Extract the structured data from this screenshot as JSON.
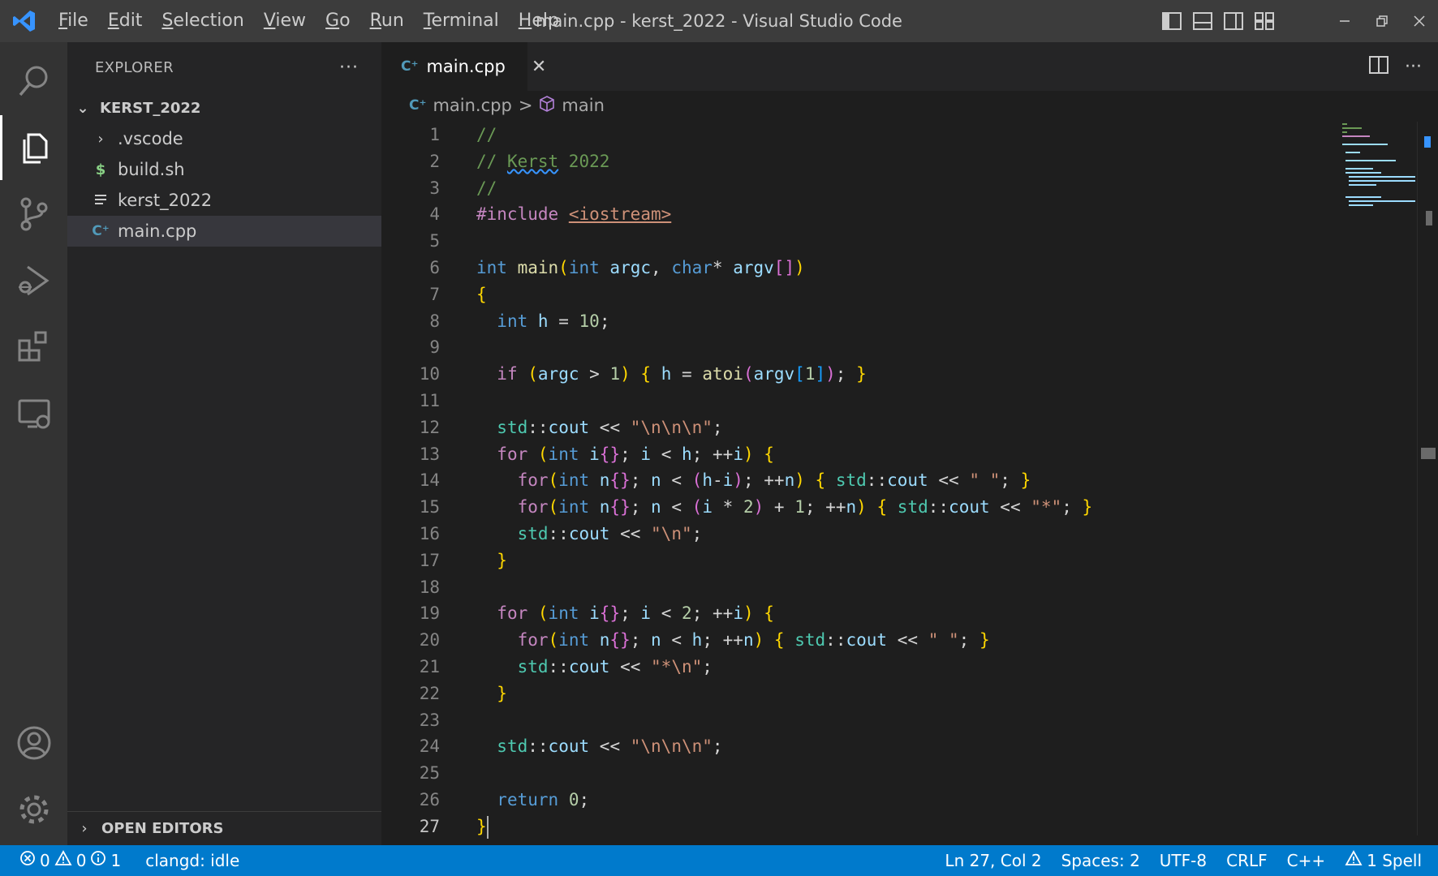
{
  "window": {
    "title": "main.cpp - kerst_2022 - Visual Studio Code",
    "menu": [
      {
        "first": "F",
        "rest": "ile"
      },
      {
        "first": "E",
        "rest": "dit"
      },
      {
        "first": "S",
        "rest": "election"
      },
      {
        "first": "V",
        "rest": "iew"
      },
      {
        "first": "G",
        "rest": "o"
      },
      {
        "first": "R",
        "rest": "un"
      },
      {
        "first": "T",
        "rest": "erminal"
      },
      {
        "first": "H",
        "rest": "elp"
      }
    ]
  },
  "sidebar": {
    "title": "EXPLORER",
    "more": "···",
    "root": "KERST_2022",
    "items": [
      {
        "label": ".vscode",
        "icon": "chevron-right-icon"
      },
      {
        "label": "build.sh",
        "icon": "dollar-icon"
      },
      {
        "label": "kerst_2022",
        "icon": "lines-icon"
      },
      {
        "label": "main.cpp",
        "icon": "cpp-icon"
      }
    ],
    "open_editors": "OPEN EDITORS"
  },
  "editor": {
    "tab_label": "main.cpp",
    "close_glyph": "✕",
    "more": "···",
    "breadcrumb": {
      "file": "main.cpp",
      "symbol": "main",
      "sep": ">"
    },
    "line_numbers": [
      "1",
      "2",
      "3",
      "4",
      "5",
      "6",
      "7",
      "8",
      "9",
      "10",
      "11",
      "12",
      "13",
      "14",
      "15",
      "16",
      "17",
      "18",
      "19",
      "20",
      "21",
      "22",
      "23",
      "24",
      "25",
      "26",
      "27"
    ],
    "lines": [
      "//",
      "// Kerst 2022",
      "//",
      "#include <iostream>",
      "",
      "int main(int argc, char* argv[])",
      "{",
      "  int h = 10;",
      "",
      "  if (argc > 1) { h = atoi(argv[1]); }",
      "",
      "  std::cout << \"\\n\\n\\n\";",
      "  for (int i{}; i < h; ++i) {",
      "    for(int n{}; n < (h-i); ++n) { std::cout << \" \"; }",
      "    for(int n{}; n < (i * 2) + 1; ++n) { std::cout << \"*\"; }",
      "    std::cout << \"\\n\";",
      "  }",
      "",
      "  for (int i{}; i < 2; ++i) {",
      "    for(int n{}; n < h; ++n) { std::cout << \" \"; }",
      "    std::cout << \"*\\n\";",
      "  }",
      "",
      "  std::cout << \"\\n\\n\\n\";",
      "",
      "  return 0;",
      "}"
    ]
  },
  "status": {
    "errors": "0",
    "warnings": "0",
    "infos": "1",
    "clangd": "clangd: idle",
    "position": "Ln 27, Col 2",
    "spaces": "Spaces: 2",
    "encoding": "UTF-8",
    "eol": "CRLF",
    "language": "C++",
    "spell": "1 Spell"
  },
  "colors": {
    "statusbar": "#007acc",
    "activitybar": "#333333",
    "sidebar": "#252526",
    "editor": "#1e1e1e",
    "titlebar": "#3c3c3c"
  }
}
